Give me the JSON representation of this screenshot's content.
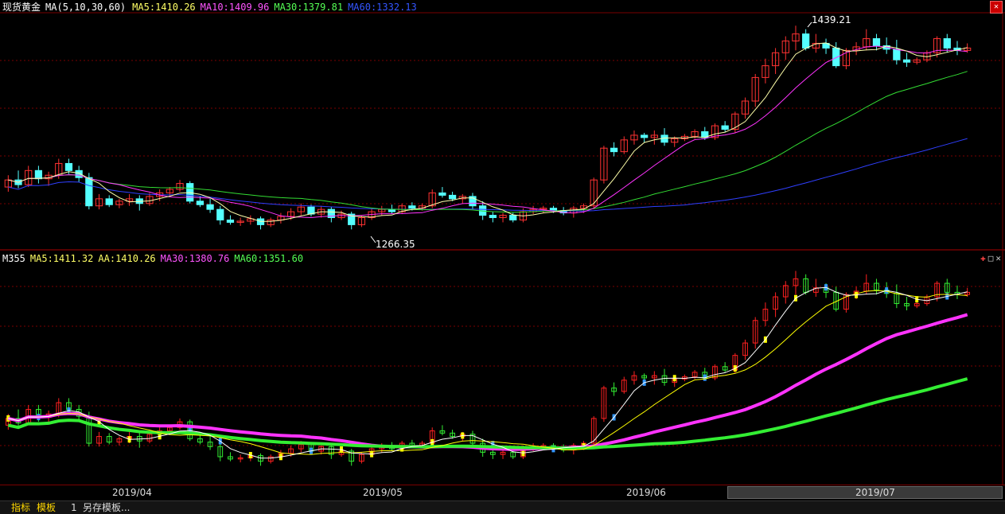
{
  "top_header": {
    "instrument": "现货黄金",
    "indicator": "MA(5,10,30,60)",
    "ma5": "MA5:1410.26",
    "ma10": "MA10:1409.96",
    "ma30": "MA30:1379.81",
    "ma60": "MA60:1332.13"
  },
  "bottom_header": {
    "name": "M355",
    "ma5": "MA5:1411.32",
    "aa": "AA:1410.26",
    "ma30": "MA30:1380.76",
    "ma60": "MA60:1351.60"
  },
  "annotations": {
    "high": "1439.21",
    "low": "1266.35"
  },
  "dates": [
    "2019/04",
    "2019/05",
    "2019/06",
    "2019/07"
  ],
  "status_bar": {
    "tab_indicator": "指标",
    "tab_template": "模板",
    "number": "1",
    "save_template": "另存模板..."
  },
  "colors": {
    "up": "#ff3232",
    "down": "#54ffff",
    "ma5": "#ffffff",
    "ma10": "#ffff00",
    "ma30": "#ff00ff",
    "ma60": "#00ff00",
    "grid": "#7a0000"
  },
  "chart_data": {
    "type": "candlestick",
    "title": "现货黄金",
    "price_range": [
      1250,
      1450
    ],
    "candles": [
      [
        1302,
        1312,
        1298,
        1308
      ],
      [
        1308,
        1316,
        1301,
        1304
      ],
      [
        1304,
        1320,
        1302,
        1316
      ],
      [
        1316,
        1320,
        1305,
        1309
      ],
      [
        1309,
        1315,
        1303,
        1312
      ],
      [
        1312,
        1326,
        1309,
        1322
      ],
      [
        1322,
        1326,
        1313,
        1316
      ],
      [
        1316,
        1320,
        1306,
        1310
      ],
      [
        1310,
        1314,
        1283,
        1286
      ],
      [
        1286,
        1296,
        1283,
        1292
      ],
      [
        1292,
        1295,
        1285,
        1287
      ],
      [
        1287,
        1292,
        1284,
        1290
      ],
      [
        1290,
        1296,
        1286,
        1292
      ],
      [
        1292,
        1295,
        1282,
        1288
      ],
      [
        1288,
        1297,
        1286,
        1294
      ],
      [
        1294,
        1300,
        1290,
        1297
      ],
      [
        1297,
        1302,
        1294,
        1300
      ],
      [
        1300,
        1308,
        1298,
        1305
      ],
      [
        1305,
        1307,
        1288,
        1290
      ],
      [
        1290,
        1294,
        1285,
        1287
      ],
      [
        1287,
        1292,
        1280,
        1283
      ],
      [
        1283,
        1286,
        1270,
        1274
      ],
      [
        1274,
        1278,
        1270,
        1272
      ],
      [
        1272,
        1276,
        1269,
        1273
      ],
      [
        1273,
        1278,
        1270,
        1275
      ],
      [
        1275,
        1277,
        1266,
        1270
      ],
      [
        1270,
        1276,
        1268,
        1274
      ],
      [
        1274,
        1280,
        1271,
        1277
      ],
      [
        1277,
        1284,
        1274,
        1281
      ],
      [
        1281,
        1288,
        1278,
        1285
      ],
      [
        1285,
        1287,
        1277,
        1279
      ],
      [
        1279,
        1286,
        1276,
        1283
      ],
      [
        1283,
        1285,
        1272,
        1276
      ],
      [
        1276,
        1282,
        1274,
        1279
      ],
      [
        1279,
        1281,
        1266,
        1270
      ],
      [
        1270,
        1278,
        1268,
        1276
      ],
      [
        1276,
        1284,
        1274,
        1281
      ],
      [
        1281,
        1286,
        1278,
        1283
      ],
      [
        1283,
        1287,
        1279,
        1281
      ],
      [
        1281,
        1288,
        1279,
        1286
      ],
      [
        1286,
        1289,
        1282,
        1284
      ],
      [
        1284,
        1288,
        1282,
        1286
      ],
      [
        1286,
        1300,
        1284,
        1297
      ],
      [
        1297,
        1302,
        1293,
        1295
      ],
      [
        1295,
        1298,
        1290,
        1292
      ],
      [
        1292,
        1296,
        1288,
        1294
      ],
      [
        1294,
        1297,
        1283,
        1286
      ],
      [
        1286,
        1290,
        1274,
        1278
      ],
      [
        1278,
        1281,
        1272,
        1276
      ],
      [
        1276,
        1280,
        1272,
        1278
      ],
      [
        1278,
        1280,
        1272,
        1274
      ],
      [
        1274,
        1284,
        1272,
        1281
      ],
      [
        1281,
        1286,
        1279,
        1283
      ],
      [
        1283,
        1286,
        1280,
        1284
      ],
      [
        1284,
        1286,
        1280,
        1282
      ],
      [
        1282,
        1285,
        1278,
        1280
      ],
      [
        1280,
        1286,
        1276,
        1284
      ],
      [
        1284,
        1288,
        1280,
        1286
      ],
      [
        1286,
        1310,
        1284,
        1308
      ],
      [
        1308,
        1337,
        1305,
        1335
      ],
      [
        1335,
        1340,
        1328,
        1332
      ],
      [
        1332,
        1345,
        1330,
        1342
      ],
      [
        1342,
        1350,
        1338,
        1346
      ],
      [
        1346,
        1348,
        1340,
        1344
      ],
      [
        1344,
        1350,
        1338,
        1346
      ],
      [
        1346,
        1352,
        1337,
        1340
      ],
      [
        1340,
        1345,
        1336,
        1343
      ],
      [
        1343,
        1347,
        1341,
        1345
      ],
      [
        1345,
        1351,
        1343,
        1349
      ],
      [
        1349,
        1353,
        1342,
        1344
      ],
      [
        1344,
        1356,
        1342,
        1354
      ],
      [
        1354,
        1358,
        1349,
        1351
      ],
      [
        1351,
        1366,
        1348,
        1364
      ],
      [
        1364,
        1378,
        1360,
        1375
      ],
      [
        1375,
        1398,
        1370,
        1395
      ],
      [
        1395,
        1411,
        1390,
        1405
      ],
      [
        1405,
        1420,
        1398,
        1416
      ],
      [
        1416,
        1430,
        1410,
        1426
      ],
      [
        1426,
        1439,
        1418,
        1432
      ],
      [
        1432,
        1436,
        1418,
        1420
      ],
      [
        1420,
        1432,
        1416,
        1424
      ],
      [
        1424,
        1428,
        1415,
        1420
      ],
      [
        1420,
        1425,
        1403,
        1405
      ],
      [
        1405,
        1420,
        1402,
        1418
      ],
      [
        1418,
        1425,
        1414,
        1421
      ],
      [
        1421,
        1436,
        1418,
        1428
      ],
      [
        1428,
        1432,
        1418,
        1422
      ],
      [
        1422,
        1429,
        1415,
        1419
      ],
      [
        1419,
        1427,
        1406,
        1410
      ],
      [
        1410,
        1416,
        1404,
        1408
      ],
      [
        1408,
        1412,
        1406,
        1410
      ],
      [
        1410,
        1418,
        1408,
        1416
      ],
      [
        1416,
        1430,
        1412,
        1428
      ],
      [
        1428,
        1432,
        1416,
        1420
      ],
      [
        1420,
        1426,
        1414,
        1418
      ],
      [
        1418,
        1424,
        1416,
        1420
      ]
    ]
  }
}
